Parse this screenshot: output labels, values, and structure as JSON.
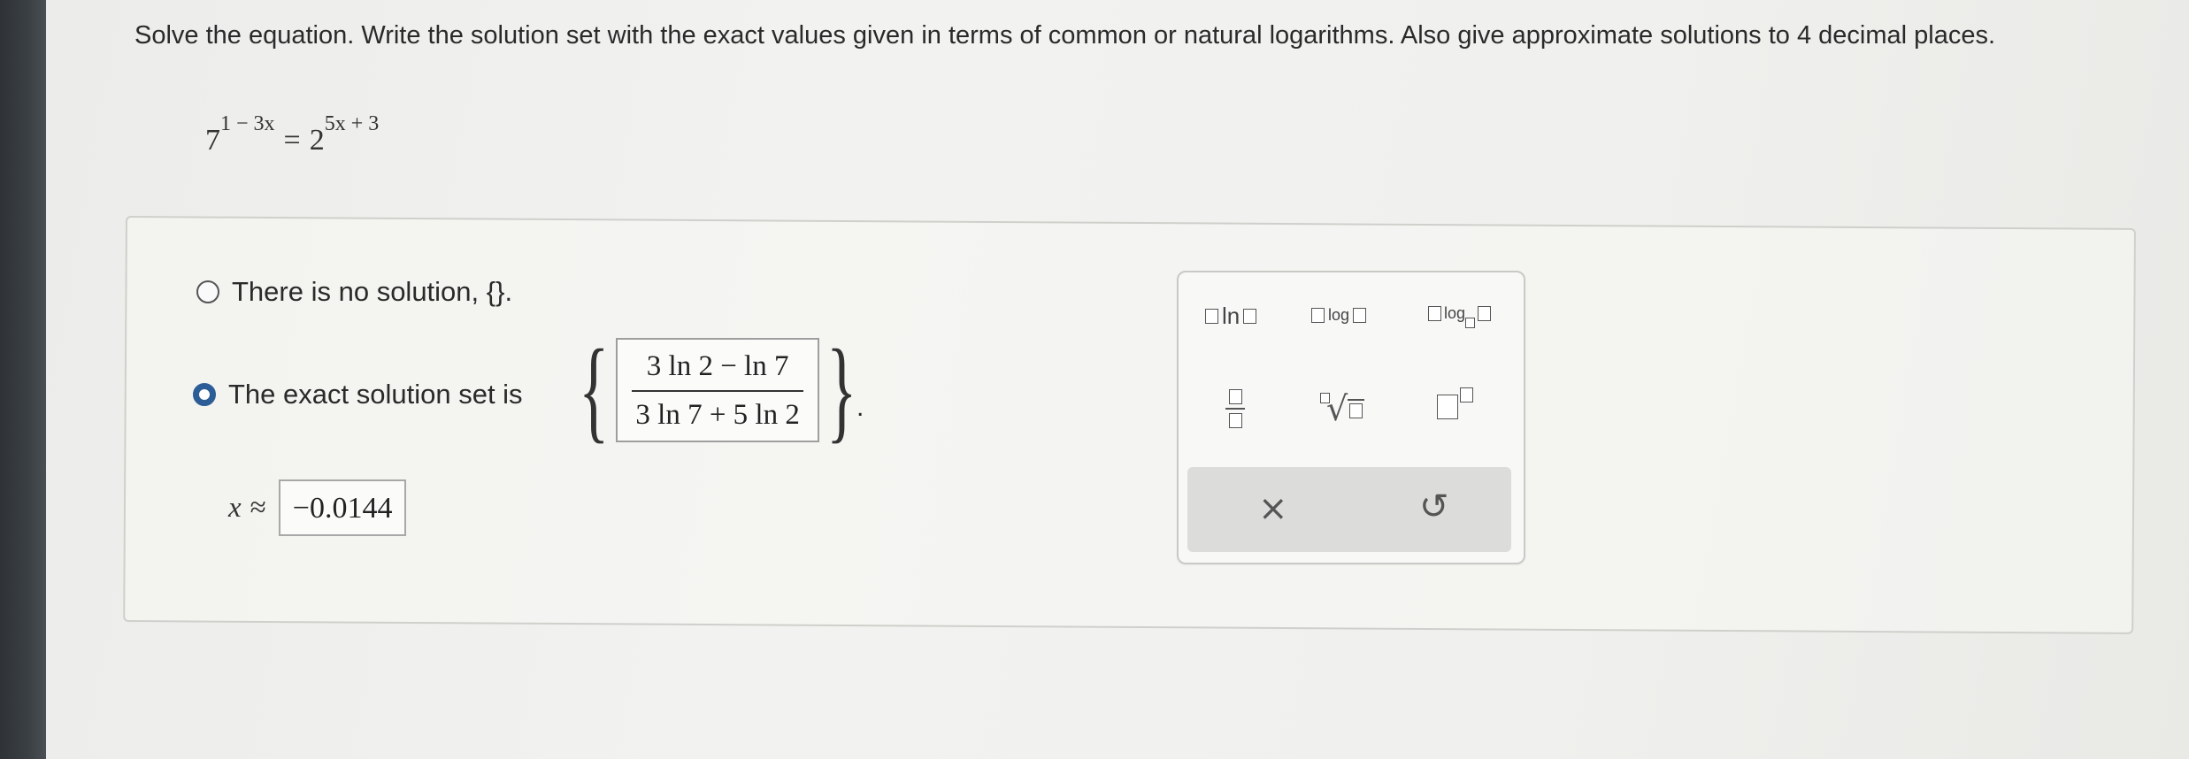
{
  "question": {
    "text": "Solve the equation. Write the solution set with the exact values given in terms of common or natural logarithms. Also give approximate solutions to 4 decimal places."
  },
  "equation": {
    "base_left": "7",
    "exp_left": "1 − 3x",
    "equals": "=",
    "base_right": "2",
    "exp_right": "5x + 3"
  },
  "options": [
    {
      "label": "There is no solution, {}.",
      "selected": false
    },
    {
      "label": "The exact solution set is",
      "selected": true
    }
  ],
  "solution": {
    "numerator": "3 ln 2 − ln 7",
    "denominator": "3 ln 7 + 5 ln 2",
    "open_brace": "{",
    "close_brace": "}",
    "period": "."
  },
  "approximation": {
    "variable": "x",
    "symbol": "≈",
    "value": "−0.0144"
  },
  "toolbox": {
    "ln_label": "ln",
    "log_label": "log",
    "logn_label": "log",
    "clear_symbol": "×",
    "undo_symbol": "↺",
    "radical_symbol": "√"
  },
  "colors": {
    "radio_selected": "#2c5d96",
    "background": "#f0f0ee"
  }
}
